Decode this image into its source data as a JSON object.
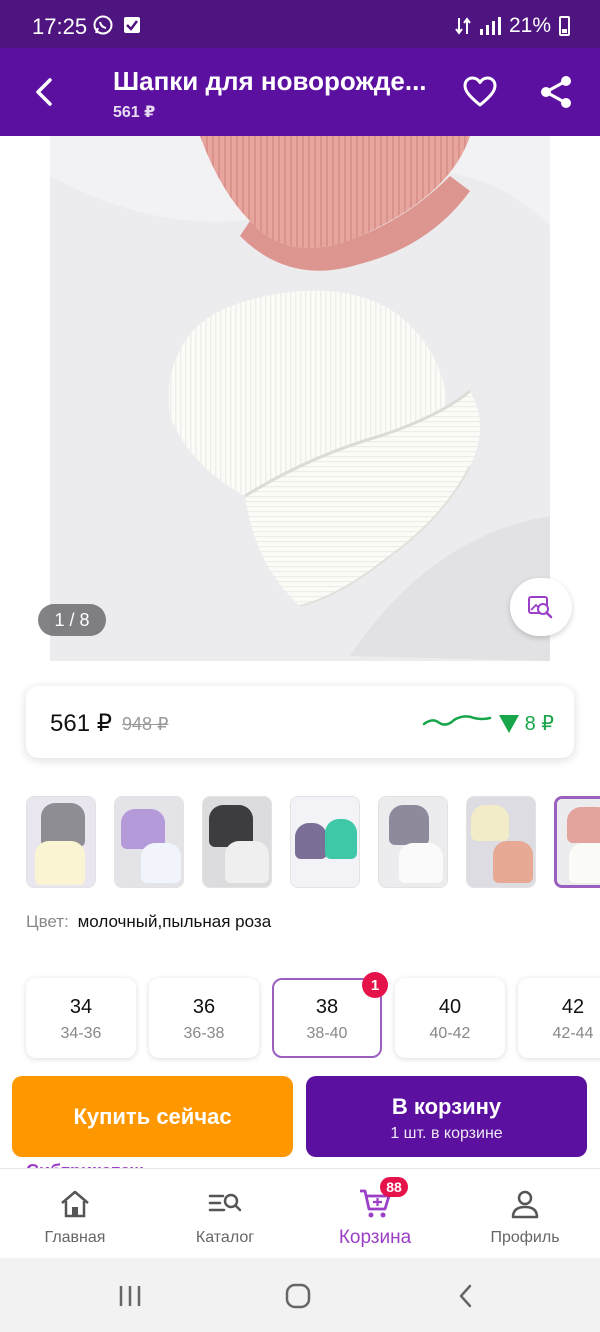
{
  "status_bar": {
    "time": "17:25",
    "battery": "21%"
  },
  "header": {
    "title": "Шапки для новорожде...",
    "subtitle": "561 ₽",
    "back_icon": "arrow-back-icon",
    "favorite_icon": "heart-outline-icon",
    "share_icon": "share-icon"
  },
  "gallery": {
    "counter": "1 / 8",
    "visual_search_icon": "image-search-icon"
  },
  "price": {
    "current": "561 ₽",
    "old": "948 ₽",
    "drop": "8 ₽",
    "drop_color": "#18a64a"
  },
  "colors": {
    "label": "Цвет:",
    "value": "молочный,пыльная роза",
    "thumbnails": [
      {
        "name": "gray-and-cream"
      },
      {
        "name": "lilac-and-white"
      },
      {
        "name": "black-and-white"
      },
      {
        "name": "purple-and-mint"
      },
      {
        "name": "gray-and-white"
      },
      {
        "name": "cream-and-peach"
      },
      {
        "name": "rose-and-white",
        "selected": true
      }
    ]
  },
  "sizes": [
    {
      "size": "34",
      "range": "34-36"
    },
    {
      "size": "36",
      "range": "36-38"
    },
    {
      "size": "38",
      "range": "38-40",
      "selected": true,
      "badge": "1"
    },
    {
      "size": "40",
      "range": "40-42"
    },
    {
      "size": "42",
      "range": "42-44"
    }
  ],
  "actions": {
    "buy_now": "Купить сейчас",
    "to_cart": "В корзину",
    "to_cart_sub": "1 шт. в корзине"
  },
  "seller_peek": "Сибтрикотаж",
  "bottom_nav": {
    "items": [
      {
        "label": "Главная",
        "icon": "home-icon"
      },
      {
        "label": "Каталог",
        "icon": "catalog-search-icon"
      },
      {
        "label": "Корзина",
        "icon": "cart-icon",
        "active": true,
        "badge": "88"
      },
      {
        "label": "Профиль",
        "icon": "profile-icon"
      }
    ]
  },
  "theme": {
    "primary": "#5b10a0",
    "accent": "#9b3fc7",
    "buy_now": "#ff9800",
    "badge": "#e5134a"
  }
}
